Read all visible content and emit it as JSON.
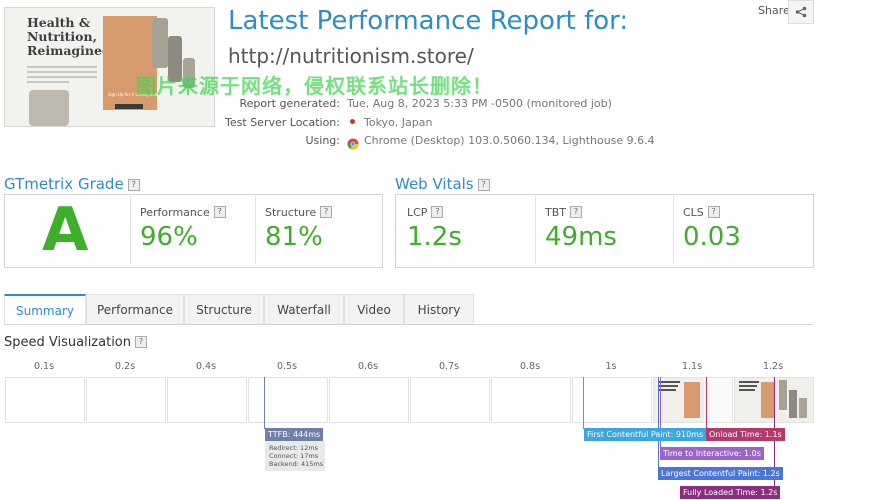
{
  "header": {
    "thumbnail": {
      "title_lines": [
        "Health &",
        "Nutrition,",
        "Reimagined"
      ],
      "card_text": "Sign Up for A Lovely Body"
    },
    "title": "Latest Performance Report for:",
    "url": "http://nutritionism.store/",
    "share_label": "Share",
    "share_icon": "share-icon",
    "meta": {
      "report_generated_label": "Report generated:",
      "report_generated_value": "Tue, Aug 8, 2023 5:33 PM -0500 (monitored job)",
      "server_label": "Test Server Location:",
      "server_value": "Tokyo, Japan",
      "using_label": "Using:",
      "using_value": "Chrome (Desktop) 103.0.5060.134, Lighthouse 9.6.4"
    },
    "watermark": "图片来源于网络，侵权联系站长删除！"
  },
  "grade": {
    "title": "GTmetrix Grade",
    "letter": "A",
    "performance_label": "Performance",
    "performance_value": "96%",
    "structure_label": "Structure",
    "structure_value": "81%"
  },
  "vitals": {
    "title": "Web Vitals",
    "lcp_label": "LCP",
    "lcp_value": "1.2s",
    "tbt_label": "TBT",
    "tbt_value": "49ms",
    "cls_label": "CLS",
    "cls_value": "0.03"
  },
  "tabs": [
    "Summary",
    "Performance",
    "Structure",
    "Waterfall",
    "Video",
    "History"
  ],
  "speed": {
    "title": "Speed Visualization",
    "ticks": [
      "0.1s",
      "0.2s",
      "0.4s",
      "0.5s",
      "0.6s",
      "0.7s",
      "0.8s",
      "1s",
      "1.1s",
      "1.2s"
    ],
    "ttfb": "TTFB: 444ms",
    "ttfb_details": [
      "Redirect: 12ms",
      "Connect: 17ms",
      "Backend: 415ms"
    ],
    "fcp": "First Contentful Paint: 910ms",
    "tti": "Time to Interactive: 1.0s",
    "lcp": "Largest Contentful Paint: 1.2s",
    "onload": "Onload Time: 1.1s",
    "fully_loaded": "Fully Loaded Time: 1.2s"
  },
  "colors": {
    "brand_blue": "#2e8dc7",
    "grade_green": "#3fae2a",
    "ttfb": "#6f7fa8",
    "fcp": "#3aa7e0",
    "tti": "#9c63c9",
    "lcp": "#4a77d6",
    "onload": "#b23a6e",
    "fully_loaded": "#8b2e7f"
  }
}
